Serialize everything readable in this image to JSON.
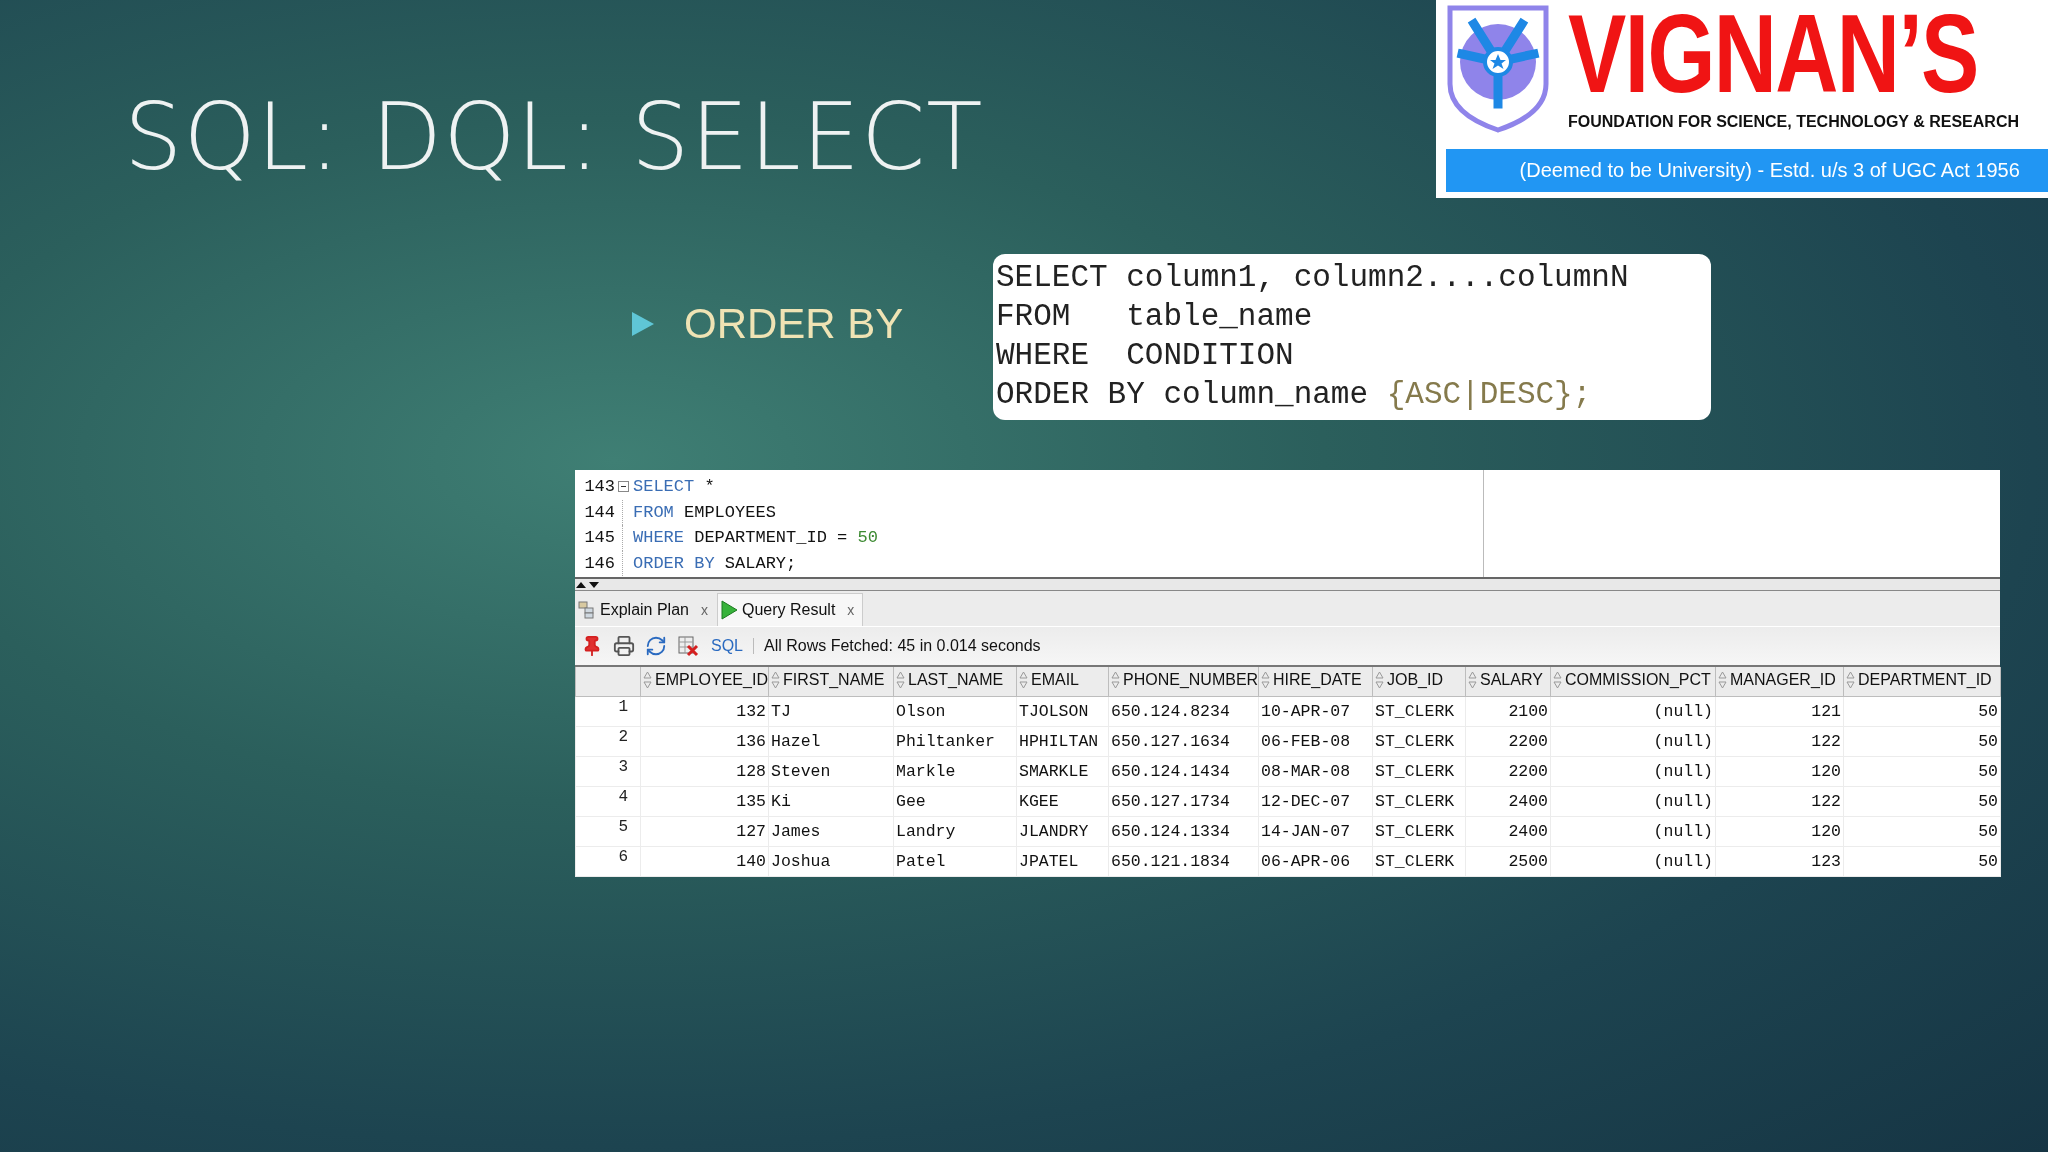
{
  "slide": {
    "title": "SQL: DQL: SELECT",
    "bullets": [
      {
        "text": "ORDER BY"
      }
    ],
    "syntax": [
      {
        "tokens": [
          {
            "kind": "plain",
            "text": "SELECT column1, column2....columnN"
          }
        ]
      },
      {
        "tokens": [
          {
            "kind": "plain",
            "text": "FROM   table_name"
          }
        ]
      },
      {
        "tokens": [
          {
            "kind": "plain",
            "text": "WHERE  CONDITION"
          }
        ]
      },
      {
        "tokens": [
          {
            "kind": "plain",
            "text": "ORDER BY column_name "
          },
          {
            "kind": "option",
            "text": "{ASC|DESC};"
          }
        ]
      }
    ]
  },
  "logo": {
    "name": "VIGNAN’S",
    "subtitle": "FOUNDATION FOR SCIENCE, TECHNOLOGY & RESEARCH",
    "banner": "(Deemed to be University) - Estd. u/s 3 of UGC Act 1956"
  },
  "editor": {
    "lines": [
      {
        "number": "143",
        "foldable": true,
        "tokens": [
          {
            "kind": "keyword",
            "text": "SELECT"
          },
          {
            "kind": "plain",
            "text": " *"
          }
        ]
      },
      {
        "number": "144",
        "foldable": false,
        "tokens": [
          {
            "kind": "keyword",
            "text": "FROM"
          },
          {
            "kind": "plain",
            "text": " EMPLOYEES"
          }
        ]
      },
      {
        "number": "145",
        "foldable": false,
        "tokens": [
          {
            "kind": "keyword",
            "text": "WHERE"
          },
          {
            "kind": "plain",
            "text": " DEPARTMENT_ID = "
          },
          {
            "kind": "number",
            "text": "50"
          }
        ]
      },
      {
        "number": "146",
        "foldable": false,
        "tokens": [
          {
            "kind": "keyword",
            "text": "ORDER BY"
          },
          {
            "kind": "plain",
            "text": " SALARY;"
          }
        ]
      }
    ]
  },
  "result_tabs": [
    {
      "label": "Explain Plan",
      "selected": false,
      "kind": "plan",
      "close": "x"
    },
    {
      "label": "Query Result",
      "selected": true,
      "kind": "result",
      "close": "x"
    }
  ],
  "toolbar": {
    "sql_link": "SQL",
    "status": "All Rows Fetched: 45 in 0.014 seconds"
  },
  "table": {
    "columns": [
      {
        "label": "EMPLOYEE_ID",
        "kind": "number"
      },
      {
        "label": "FIRST_NAME",
        "kind": "text"
      },
      {
        "label": "LAST_NAME",
        "kind": "text"
      },
      {
        "label": "EMAIL",
        "kind": "text"
      },
      {
        "label": "PHONE_NUMBER",
        "kind": "text"
      },
      {
        "label": "HIRE_DATE",
        "kind": "text"
      },
      {
        "label": "JOB_ID",
        "kind": "text"
      },
      {
        "label": "SALARY",
        "kind": "number"
      },
      {
        "label": "COMMISSION_PCT",
        "kind": "number"
      },
      {
        "label": "MANAGER_ID",
        "kind": "number"
      },
      {
        "label": "DEPARTMENT_ID",
        "kind": "number"
      }
    ],
    "rows": [
      {
        "number": "1",
        "cells": [
          "132",
          "TJ",
          "Olson",
          "TJOLSON",
          "650.124.8234",
          "10-APR-07",
          "ST_CLERK",
          "2100",
          "(null)",
          "121",
          "50"
        ]
      },
      {
        "number": "2",
        "cells": [
          "136",
          "Hazel",
          "Philtanker",
          "HPHILTAN",
          "650.127.1634",
          "06-FEB-08",
          "ST_CLERK",
          "2200",
          "(null)",
          "122",
          "50"
        ]
      },
      {
        "number": "3",
        "cells": [
          "128",
          "Steven",
          "Markle",
          "SMARKLE",
          "650.124.1434",
          "08-MAR-08",
          "ST_CLERK",
          "2200",
          "(null)",
          "120",
          "50"
        ]
      },
      {
        "number": "4",
        "cells": [
          "135",
          "Ki",
          "Gee",
          "KGEE",
          "650.127.1734",
          "12-DEC-07",
          "ST_CLERK",
          "2400",
          "(null)",
          "122",
          "50"
        ]
      },
      {
        "number": "5",
        "cells": [
          "127",
          "James",
          "Landry",
          "JLANDRY",
          "650.124.1334",
          "14-JAN-07",
          "ST_CLERK",
          "2400",
          "(null)",
          "120",
          "50"
        ]
      },
      {
        "number": "6",
        "cells": [
          "140",
          "Joshua",
          "Patel",
          "JPATEL",
          "650.121.1834",
          "06-APR-06",
          "ST_CLERK",
          "2500",
          "(null)",
          "123",
          "50"
        ]
      }
    ]
  }
}
